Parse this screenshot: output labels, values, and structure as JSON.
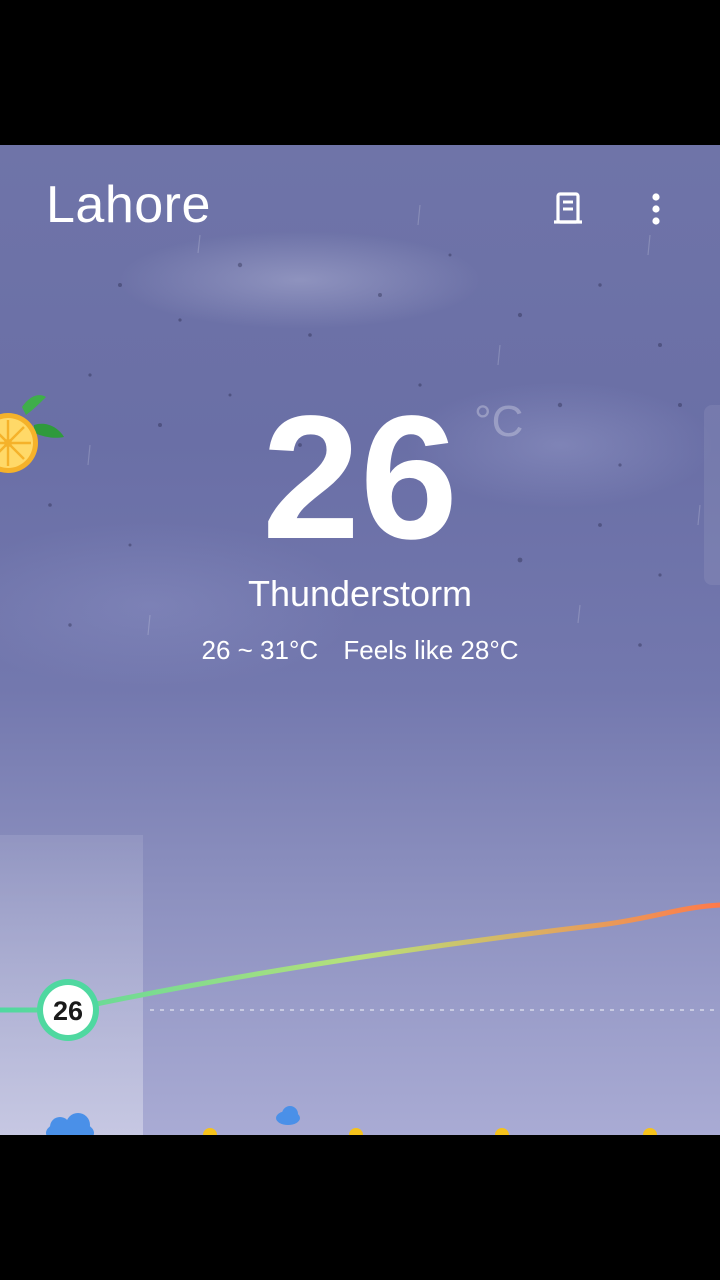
{
  "header": {
    "city": "Lahore",
    "list_icon": "city-list-icon",
    "menu_icon": "more-vertical-icon"
  },
  "current": {
    "temperature": "26",
    "unit": "°C",
    "condition": "Thunderstorm",
    "range": "26 ~ 31°C",
    "feels_like": "Feels like 28°C"
  },
  "hourly": {
    "now_temp_label": "26",
    "colors": {
      "line_start": "#4fd8a0",
      "line_mid": "#b8e07a",
      "line_end": "#ff7a4a"
    },
    "icons": [
      "cloud-icon",
      "sun-icon",
      "rain-cloud-icon",
      "sun-icon",
      "sun-icon",
      "sun-icon"
    ]
  },
  "decoration": {
    "icon": "orange-slice-icon"
  }
}
